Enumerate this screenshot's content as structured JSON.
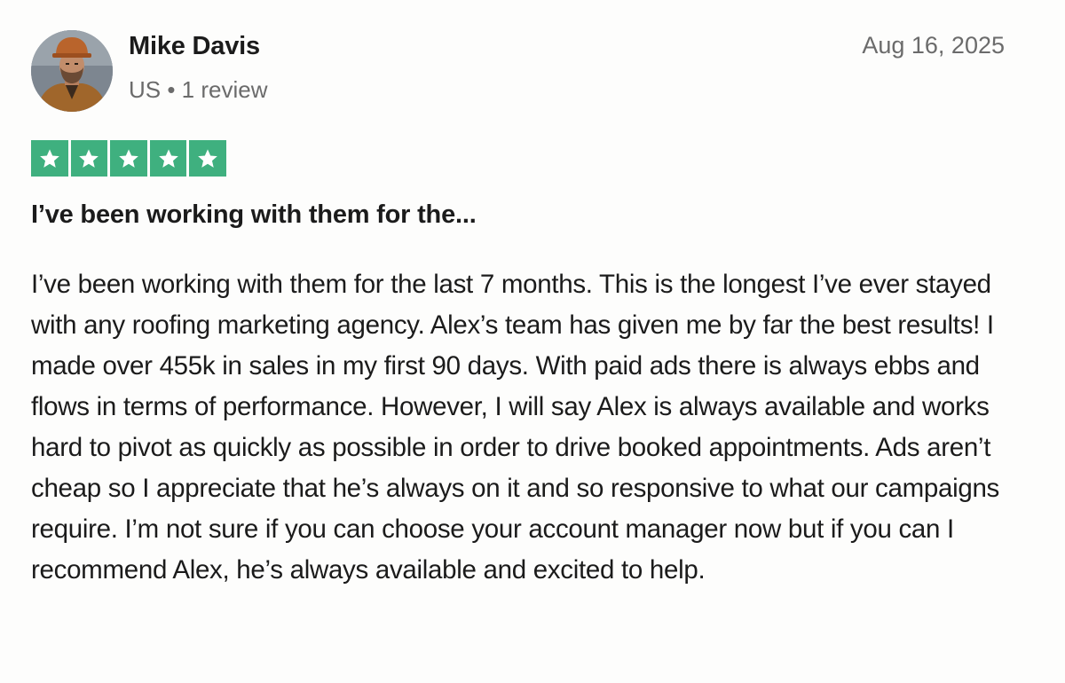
{
  "review": {
    "reviewer": {
      "name": "Mike Davis",
      "meta": "US • 1 review",
      "avatar": "reviewer-photo"
    },
    "date": "Aug 16, 2025",
    "rating": {
      "value": 5,
      "max": 5,
      "color": "#3fb07f",
      "icon": "star-icon"
    },
    "title": "I’ve been working with them for the...",
    "body": "I’ve been working with them for the last 7 months. This is the longest I’ve ever stayed with any roofing marketing agency. Alex’s team has given me by far the best results! I made over 455k in sales in my first 90 days. With paid ads there is always ebbs and flows in terms of performance. However, I will say Alex is always available and works hard to pivot as quickly as possible in order to drive booked appointments. Ads aren’t cheap so I appreciate that he’s always on it and so responsive to what our campaigns require. I’m not sure if you can choose your account manager now but if you can I recommend Alex, he’s always available and excited to help."
  }
}
